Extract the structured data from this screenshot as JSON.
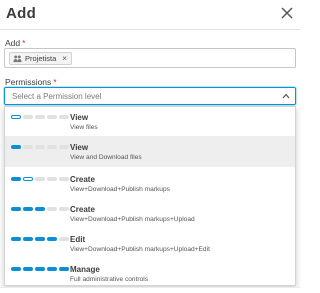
{
  "dialog": {
    "title": "Add",
    "close_icon": "close-icon"
  },
  "add_field": {
    "label": "Add",
    "required_mark": "*",
    "chips": [
      {
        "label": "Projetista",
        "icon": "group-icon",
        "remove": "×"
      }
    ]
  },
  "permissions_field": {
    "label": "Permissions",
    "required_mark": "*",
    "placeholder": "Select a Permission level",
    "chevron_icon": "chevron-up-icon"
  },
  "accent_color": "#0a8fd6",
  "menu": {
    "items": [
      {
        "title": "View",
        "desc": "View files",
        "level": "0 of 5 filled, first segment outlined",
        "hover": false
      },
      {
        "title": "View",
        "desc": "View and Download files",
        "level": "1 of 5 filled",
        "hover": true
      },
      {
        "title": "Create",
        "desc": "View+Download+Publish markups",
        "level": "1 of 5 filled, second segment outlined",
        "hover": false
      },
      {
        "title": "Create",
        "desc": "View+Download+Publish markups+Upload",
        "level": "3 of 5 filled",
        "hover": false
      },
      {
        "title": "Edit",
        "desc": "View+Download+Publish markups+Upload+Edit",
        "level": "4 of 5 filled",
        "hover": false
      },
      {
        "title": "Manage",
        "desc": "Full administrative controls",
        "level": "5 of 5 filled",
        "hover": false
      }
    ]
  }
}
